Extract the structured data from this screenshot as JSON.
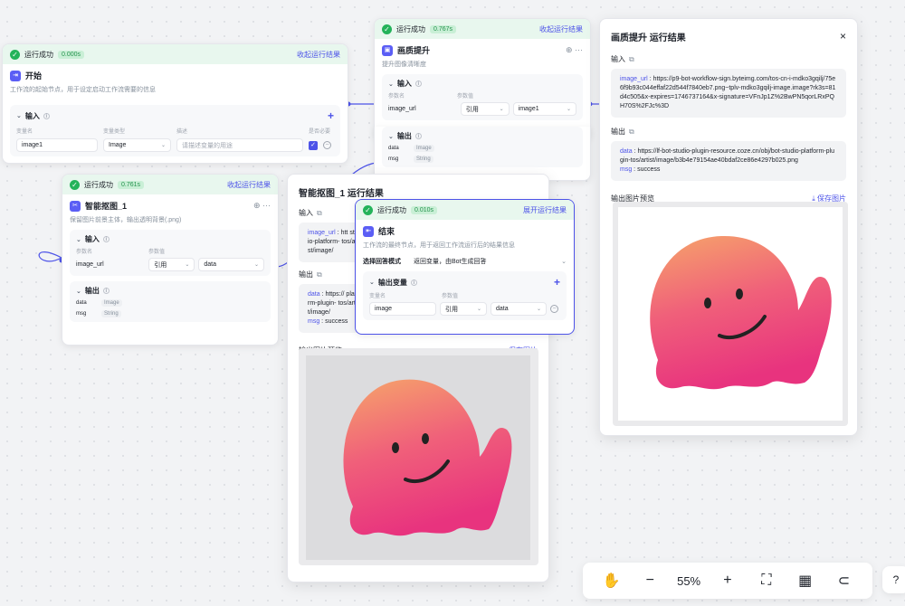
{
  "start_node": {
    "status": "运行成功",
    "time": "0.000s",
    "link": "收起运行结果",
    "title": "开始",
    "desc": "工作流的起始节点，用于设定启动工作流需要的信息",
    "input_label": "输入",
    "cols": [
      "变量名",
      "变量类型",
      "描述",
      "是否必要"
    ],
    "row": {
      "name": "image1",
      "type": "Image",
      "placeholder": "请描述变量的用途"
    }
  },
  "upscale_node": {
    "status": "运行成功",
    "time": "0.767s",
    "link": "收起运行结果",
    "title": "画质提升",
    "desc": "提升图像清晰度",
    "input_label": "输入",
    "cols": [
      "参数名",
      "参数值"
    ],
    "row": {
      "name": "image_url",
      "mode": "引用",
      "value": "image1"
    },
    "output_label": "输出",
    "outputs": [
      {
        "name": "data",
        "type": "Image"
      },
      {
        "name": "msg",
        "type": "String"
      }
    ]
  },
  "matting_node": {
    "status": "运行成功",
    "time": "0.761s",
    "link": "收起运行结果",
    "title": "智能抠图_1",
    "desc": "保留图片前景主体，输出透明背景(.png)",
    "input_label": "输入",
    "cols": [
      "参数名",
      "参数值"
    ],
    "row": {
      "name": "image_url",
      "mode": "引用",
      "value": "data"
    },
    "output_label": "输出",
    "outputs": [
      {
        "name": "data",
        "type": "Image"
      },
      {
        "name": "msg",
        "type": "String"
      }
    ]
  },
  "end_node": {
    "status": "运行成功",
    "time": "0.010s",
    "link": "展开运行结果",
    "title": "结束",
    "desc": "工作流的最终节点，用于返回工作流运行后的结果信息",
    "mode_label": "选择回答模式",
    "mode_value": "返回变量，由Bot生成回答",
    "output_label": "输出变量",
    "cols": [
      "变量名",
      "参数值"
    ],
    "row": {
      "name": "image",
      "mode": "引用",
      "value": "data"
    }
  },
  "matting_panel": {
    "title": "智能抠图_1 运行结果",
    "input_label": "输入",
    "input_key": "image_url",
    "input_value": "htt studio-platform- tos/artist/image/",
    "output_label": "输出",
    "output_key": "data",
    "output_value": "https:// platform-plugin- tos/artist/image/",
    "msg_key": "msg",
    "msg_value": "success",
    "preview_label": "输出图片预览",
    "save_label": "保存图片"
  },
  "upscale_panel": {
    "title": "画质提升 运行结果",
    "close": "×",
    "input_label": "输入",
    "input_key": "image_url",
    "input_value": "https://p9-bot-workflow-sign.byteimg.com/tos-cn-i-mdko3gqilj/75e6f9b93c044effaf22d544f7840eb7.png~tplv-mdko3gqilj-image.image?rk3s=81d4c505&x-expires=1746737164&x-signature=VFnJp1Z%2BwPN5qorLRxPQH70S%2FJc%3D",
    "output_label": "输出",
    "output_key": "data",
    "output_value": "https://lf-bot-studio-plugin-resource.coze.cn/obj/bot-studio-platform-plugin-tos/artist/image/b3b4e79154ae40bdaf2ce86e4297b025.png",
    "msg_key": "msg",
    "msg_value": "success",
    "preview_label": "输出图片预览",
    "save_label": "保存图片"
  },
  "toolbar": {
    "zoom": "55%"
  },
  "colors": {
    "accent": "#4d53e8",
    "success": "#24b35a",
    "success_bg": "#e8f7ee"
  }
}
